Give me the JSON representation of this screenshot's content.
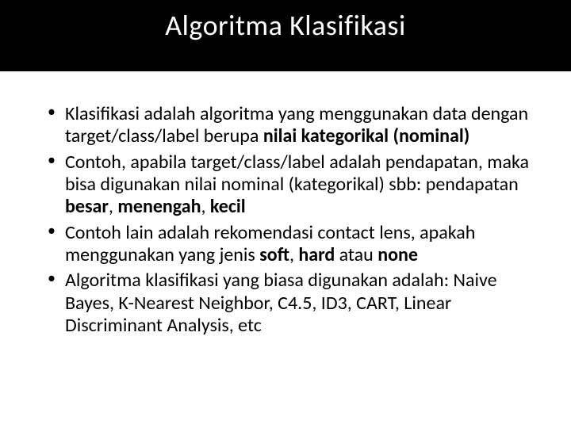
{
  "title": "Algoritma Klasifikasi",
  "bullets": [
    {
      "t1": "Klasifikasi adalah algoritma yang menggunakan data dengan target/class/label berupa ",
      "b1": "nilai kategorikal (nominal)",
      "t2": ""
    },
    {
      "t1": "Contoh, apabila target/class/label adalah pendapatan, maka bisa digunakan nilai nominal (kategorikal) sbb: pendapatan ",
      "b1": "besar",
      "t2": ", ",
      "b2": "menengah",
      "t3": ", ",
      "b3": "kecil",
      "t4": ""
    },
    {
      "t1": "Contoh lain adalah rekomendasi contact lens, apakah menggunakan yang jenis ",
      "b1": "soft",
      "t2": ", ",
      "b2": "hard",
      "t3": " atau ",
      "b3": "none",
      "t4": ""
    },
    {
      "t1": "Algoritma klasifikasi yang biasa digunakan adalah: Naive Bayes, K-Nearest Neighbor, C4.5, ID3, CART, Linear Discriminant Analysis, etc"
    }
  ]
}
